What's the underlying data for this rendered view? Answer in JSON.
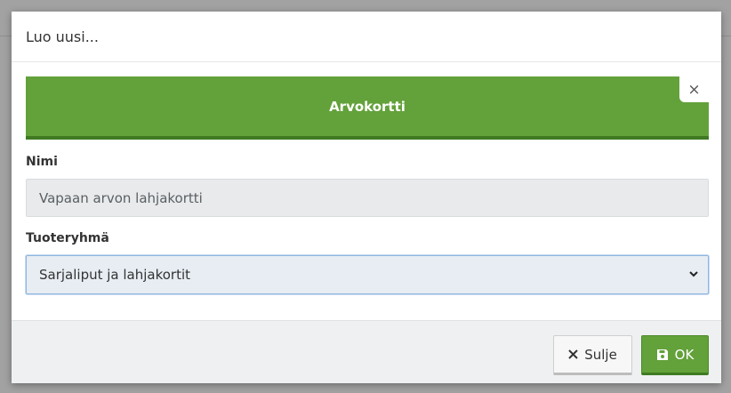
{
  "dialog": {
    "title": "Luo uusi..."
  },
  "product_card": {
    "name": "Arvokortti",
    "close_glyph": "×",
    "color": "#63a13a"
  },
  "fields": {
    "name_label": "Nimi",
    "name_value": "Vapaan arvon lahjakortti",
    "group_label": "Tuoteryhmä",
    "group_value": "Sarjaliput ja lahjakortit"
  },
  "footer": {
    "close_label": "Sulje",
    "ok_label": "OK"
  },
  "icons": {
    "close_button_icon": "x-icon",
    "ok_button_icon": "save-icon",
    "select_icon": "chevron-down-icon",
    "card_close_icon": "close-icon"
  }
}
